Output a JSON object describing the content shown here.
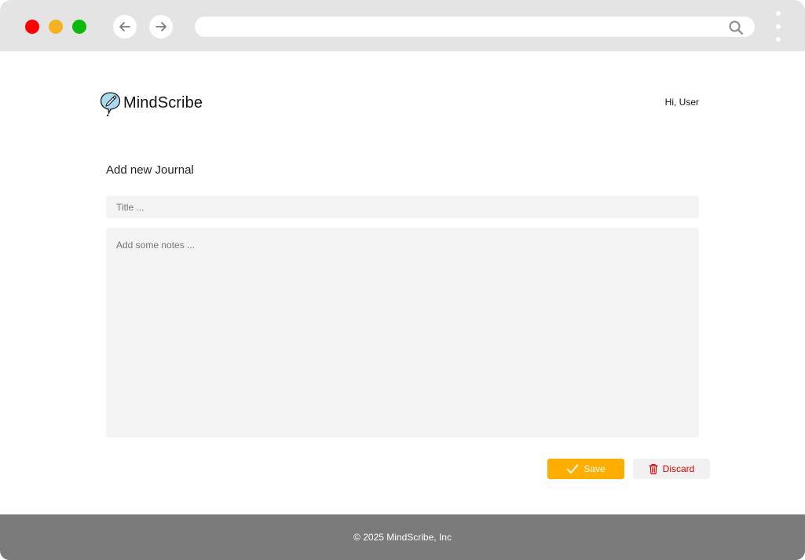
{
  "browser": {
    "back_icon": "arrow-left-icon",
    "forward_icon": "arrow-right-icon",
    "search_icon": "search-icon",
    "url": "",
    "traffic_colors": {
      "close": "#ff0000",
      "minimize": "#f5b120",
      "maximize": "#0db80d"
    }
  },
  "header": {
    "app_name": "MindScribe",
    "logo_icon": "quill-bubble-icon",
    "greeting": "Hi, User"
  },
  "form": {
    "heading": "Add new Journal",
    "title_value": "",
    "title_placeholder": "Title ...",
    "notes_value": "",
    "notes_placeholder": "Add some notes ..."
  },
  "actions": {
    "save_label": "Save",
    "save_icon": "check-icon",
    "save_color": "#ffae00",
    "discard_label": "Discard",
    "discard_icon": "trash-icon",
    "discard_color": "#d40000"
  },
  "footer": {
    "copyright": "© 2025 MindScribe, Inc"
  }
}
